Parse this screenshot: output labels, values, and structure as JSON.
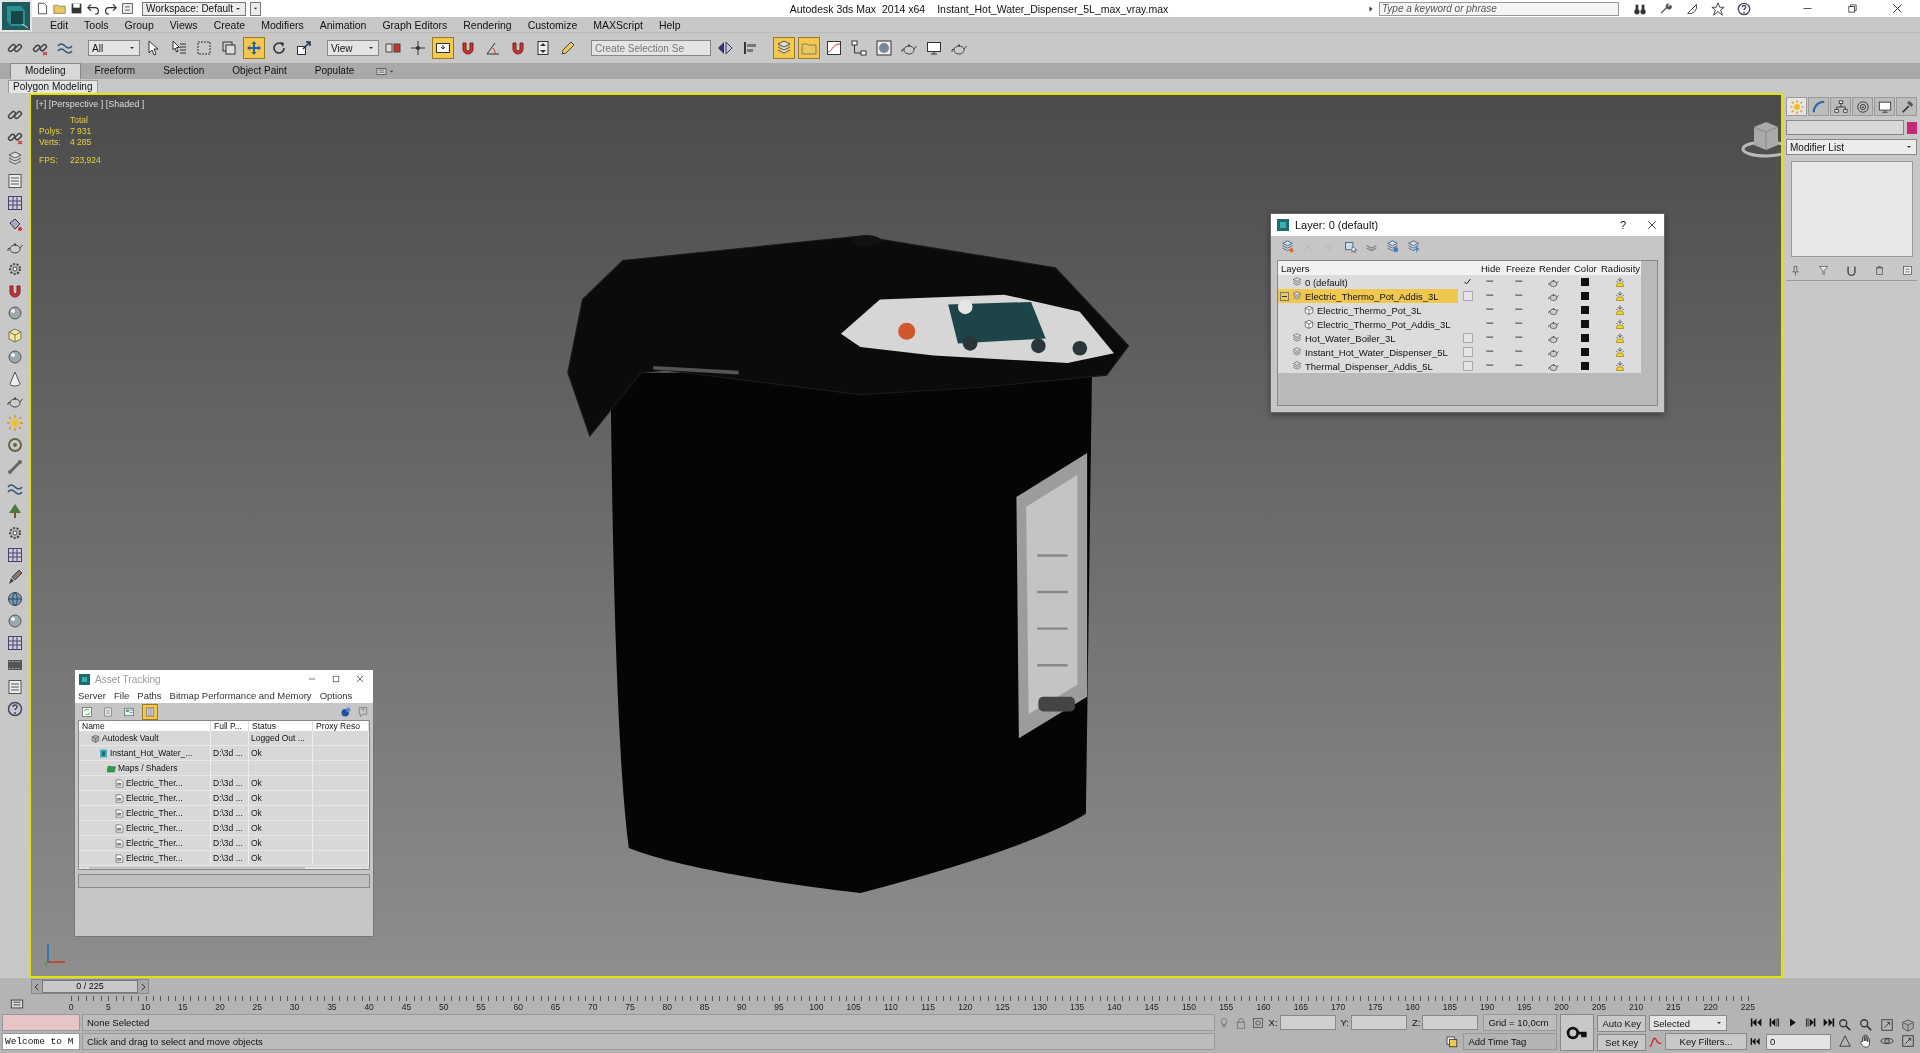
{
  "title_bar": {
    "workspace": "Workspace: Default",
    "app_title": "Autodesk 3ds Max  2014 x64",
    "file_name": "Instant_Hot_Water_Dispenser_5L_max_vray.max",
    "search": {
      "placeholder": "Type a keyword or phrase"
    }
  },
  "menu": [
    "Edit",
    "Tools",
    "Group",
    "Views",
    "Create",
    "Modifiers",
    "Animation",
    "Graph Editors",
    "Rendering",
    "Customize",
    "MAXScript",
    "Help"
  ],
  "main_toolbar": {
    "tools": [
      {
        "kind": "link",
        "selected": false
      },
      {
        "kind": "unlink",
        "selected": false
      },
      {
        "kind": "bind",
        "selected": false
      },
      {
        "kind": "selection_filter",
        "value": "All"
      },
      {
        "kind": "select",
        "selected": false
      },
      {
        "kind": "select_by_name",
        "selected": false
      },
      {
        "kind": "rect_region",
        "selected": false
      },
      {
        "kind": "window_crossing",
        "selected": false
      },
      {
        "kind": "move",
        "selected": true
      },
      {
        "kind": "rotate",
        "selected": false
      },
      {
        "kind": "scale",
        "selected": false
      },
      {
        "kind": "reference_coordinate",
        "value": "View"
      },
      {
        "kind": "pivot",
        "selected": false
      },
      {
        "kind": "manipulate",
        "selected": false
      },
      {
        "kind": "keyboard_override",
        "selected": true
      },
      {
        "kind": "snap",
        "selected": false
      },
      {
        "kind": "angle_snap",
        "selected": false
      },
      {
        "kind": "percent_snap",
        "selected": false
      },
      {
        "kind": "spinner_snap",
        "selected": false
      },
      {
        "kind": "edit_named_sets",
        "selected": false
      },
      {
        "kind": "named_selection",
        "placeholder": "Create Selection Se"
      },
      {
        "kind": "mirror",
        "selected": false
      },
      {
        "kind": "align",
        "selected": false
      },
      {
        "kind": "layer_explorer",
        "selected": true
      },
      {
        "kind": "scene_explorer",
        "selected": true
      },
      {
        "kind": "curve_editor",
        "selected": false
      },
      {
        "kind": "schematic",
        "selected": false
      },
      {
        "kind": "material_editor",
        "selected": false
      },
      {
        "kind": "render_setup",
        "selected": false
      },
      {
        "kind": "frame_window",
        "selected": false
      },
      {
        "kind": "render",
        "selected": false
      }
    ]
  },
  "ribbon": {
    "tabs": [
      {
        "label": "Modeling",
        "selected": true
      },
      {
        "label": "Freeform",
        "selected": false
      },
      {
        "label": "Selection",
        "selected": false
      },
      {
        "label": "Object Paint",
        "selected": false
      },
      {
        "label": "Populate",
        "selected": false
      }
    ],
    "panel_tab": "Polygon Modeling"
  },
  "viewport": {
    "label": "[+] [Perspective ] [Shaded ]",
    "stats": {
      "heading": "Total",
      "rows": [
        {
          "label": "Polys:",
          "value": "7 931"
        },
        {
          "label": "Verts:",
          "value": "4 285"
        }
      ],
      "fps_label": "FPS:",
      "fps_value": "223,924"
    }
  },
  "layer_dialog": {
    "title": "Layer: 0 (default)",
    "help": "?",
    "columns": [
      "Layers",
      "Hide",
      "Freeze",
      "Render",
      "Color",
      "Radiosity"
    ],
    "layers": [
      {
        "name": "0 (default)",
        "kind": "layer",
        "current": true,
        "selected": false,
        "color": "#111111"
      },
      {
        "name": "Electric_Thermo_Pot_Addis_3L",
        "kind": "layer",
        "current": false,
        "selected": true,
        "expanded": true,
        "color": "#111111",
        "children": [
          {
            "name": "Electric_Thermo_Pot_3L",
            "kind": "object",
            "selected": false,
            "color": "#111111"
          },
          {
            "name": "Electric_Thermo_Pot_Addis_3L",
            "kind": "object",
            "selected": false,
            "color": "#111111"
          }
        ]
      },
      {
        "name": "Hot_Water_Boiler_3L",
        "kind": "layer",
        "current": false,
        "selected": false,
        "color": "#111111"
      },
      {
        "name": "Instant_Hot_Water_Dispenser_5L",
        "kind": "layer",
        "current": false,
        "selected": false,
        "color": "#111111"
      },
      {
        "name": "Thermal_Dispenser_Addis_5L",
        "kind": "layer",
        "current": false,
        "selected": false,
        "color": "#111111"
      }
    ]
  },
  "asset_tracking": {
    "title": "Asset Tracking",
    "menu": [
      "Server",
      "File",
      "Paths",
      "Bitmap Performance and Memory",
      "Options"
    ],
    "view_buttons": [
      {
        "selected": false
      },
      {
        "selected": false
      },
      {
        "selected": false
      },
      {
        "selected": true
      }
    ],
    "columns": [
      "Name",
      "Full P...",
      "Status",
      "Proxy Reso"
    ],
    "rows": [
      {
        "name": "Autodesk Vault",
        "kind": "vault",
        "status": "Logged Out ...",
        "children": [
          {
            "name": "Instant_Hot_Water_...",
            "kind": "scene",
            "full_path": "D:\\3d ...",
            "status": "Ok",
            "children": [
              {
                "name": "Maps / Shaders",
                "kind": "folder",
                "children": [
                  {
                    "name": "Electric_Ther...",
                    "kind": "bitmap",
                    "full_path": "D:\\3d ...",
                    "status": "Ok"
                  },
                  {
                    "name": "Electric_Ther...",
                    "kind": "bitmap",
                    "full_path": "D:\\3d ...",
                    "status": "Ok"
                  },
                  {
                    "name": "Electric_Ther...",
                    "kind": "bitmap",
                    "full_path": "D:\\3d ...",
                    "status": "Ok"
                  },
                  {
                    "name": "Electric_Ther...",
                    "kind": "bitmap",
                    "full_path": "D:\\3d ...",
                    "status": "Ok"
                  },
                  {
                    "name": "Electric_Ther...",
                    "kind": "bitmap",
                    "full_path": "D:\\3d ...",
                    "status": "Ok"
                  },
                  {
                    "name": "Electric_Ther...",
                    "kind": "bitmap",
                    "full_path": "D:\\3d ...",
                    "status": "Ok"
                  }
                ]
              }
            ]
          }
        ]
      }
    ]
  },
  "command_panel": {
    "tabs": [
      {
        "selected": true
      },
      {
        "selected": false
      },
      {
        "selected": false
      },
      {
        "selected": false
      },
      {
        "selected": false
      },
      {
        "selected": false
      }
    ],
    "modifier_list": "Modifier List"
  },
  "timeline": {
    "frame_counter": "0 / 225",
    "ticks": [
      "0",
      "5",
      "10",
      "15",
      "20",
      "25",
      "30",
      "35",
      "40",
      "45",
      "50",
      "55",
      "60",
      "65",
      "70",
      "75",
      "80",
      "85",
      "90",
      "95",
      "100",
      "105",
      "110",
      "115",
      "120",
      "125",
      "130",
      "135",
      "140",
      "145",
      "150",
      "155",
      "160",
      "165",
      "170",
      "175",
      "180",
      "185",
      "190",
      "195",
      "200",
      "205",
      "210",
      "215",
      "220",
      "225"
    ]
  },
  "status_bar": {
    "listener": "Welcome to M",
    "selection": "None Selected",
    "prompt": "Click and drag to select and move objects",
    "coords": [
      "X:",
      "Y:",
      "Z:"
    ],
    "grid": "Grid = 10,0cm",
    "add_time_tag": "Add Time Tag",
    "auto_key": "Auto Key",
    "set_key": "Set Key",
    "key_mode": "Selected",
    "key_filters": "Key Filters...",
    "current_frame": "0"
  }
}
